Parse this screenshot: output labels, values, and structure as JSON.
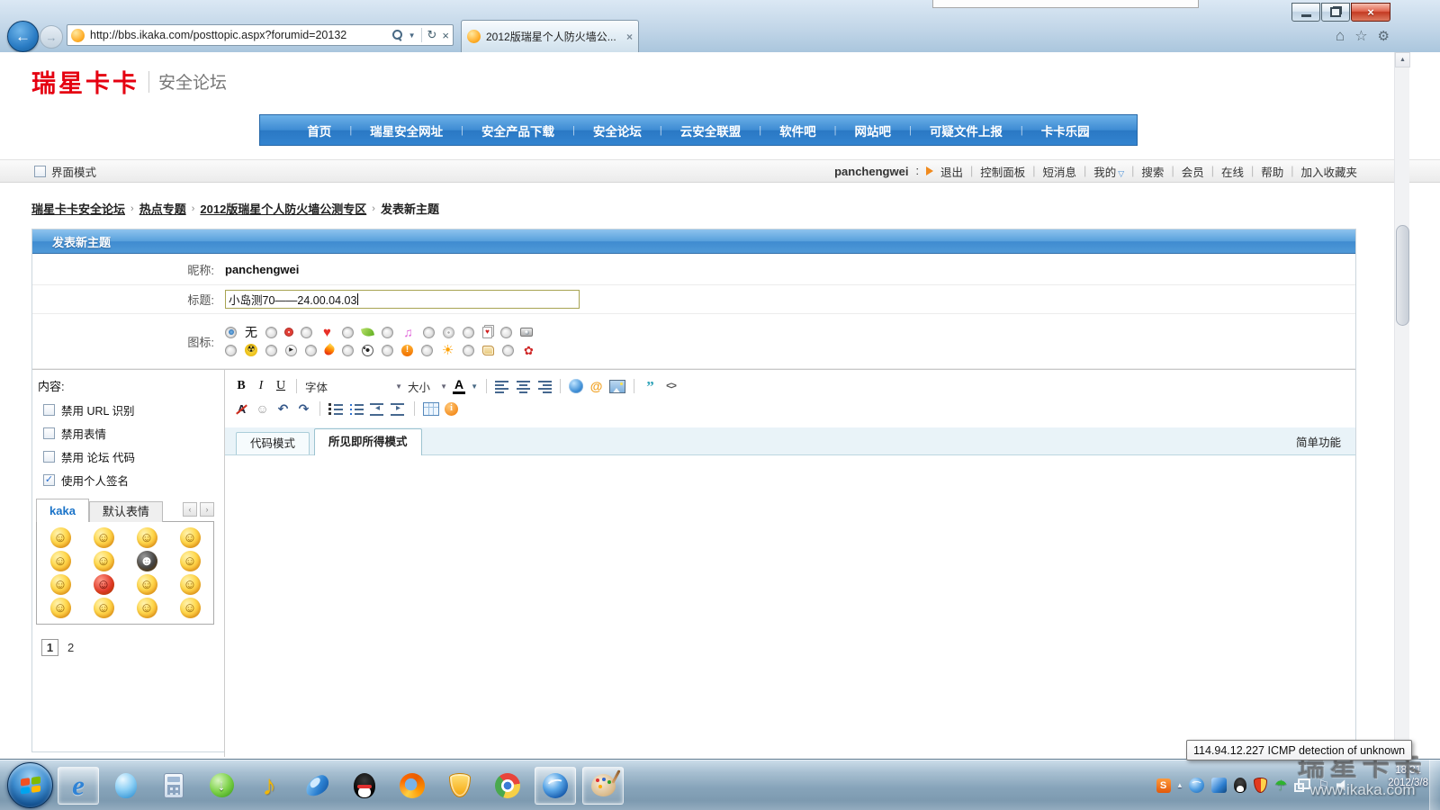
{
  "browser": {
    "url": "http://bbs.ikaka.com/posttopic.aspx?forumid=20132",
    "tab_title": "2012版瑞星个人防火墙公..."
  },
  "site": {
    "logo": "瑞星卡卡",
    "tagline": "安全论坛"
  },
  "nav": {
    "separator": "|",
    "items": [
      "首页",
      "瑞星安全网址",
      "安全产品下载",
      "安全论坛",
      "云安全联盟",
      "软件吧",
      "网站吧",
      "可疑文件上报",
      "卡卡乐园"
    ]
  },
  "userbar": {
    "interface_mode_label": "界面模式",
    "username": "panchengwei",
    "username_suffix": ":",
    "logout_label": "退出",
    "separator": "|",
    "links": [
      "控制面板",
      "短消息",
      "我的",
      "搜索",
      "会员",
      "在线",
      "帮助",
      "加入收藏夹"
    ]
  },
  "breadcrumb": {
    "separator": "›",
    "links": [
      "瑞星卡卡安全论坛",
      "热点专题",
      "2012版瑞星个人防火墙公测专区"
    ],
    "current": "发表新主题"
  },
  "post_form": {
    "panel_title": "发表新主题",
    "nickname_label": "昵称:",
    "nickname_value": "panchengwei",
    "title_label": "标题:",
    "title_value": "小岛测70——24.00.04.03",
    "icon_label": "图标:",
    "icon_none_label": "无",
    "icon_row1": [
      "lifebuoy",
      "heart",
      "leaf",
      "music-notes",
      "disc",
      "poker-cards",
      "camera"
    ],
    "icon_row2": [
      "radiation",
      "play",
      "flame",
      "soccer-ball",
      "alert",
      "sun",
      "scroll",
      "rose"
    ]
  },
  "content_options": {
    "label": "内容:",
    "checkboxes": [
      {
        "label": "禁用 URL 识别",
        "checked": false
      },
      {
        "label": "禁用表情",
        "checked": false
      },
      {
        "label": "禁用 论坛 代码",
        "checked": false
      },
      {
        "label": "使用个人签名",
        "checked": true
      }
    ]
  },
  "emoticon_panel": {
    "tabs": [
      {
        "label": "kaka",
        "active": true
      },
      {
        "label": "默认表情",
        "active": false
      }
    ],
    "smileys": [
      "smile",
      "laugh",
      "surprise",
      "cry",
      "shy",
      "sweat",
      "bomb-black",
      "shock",
      "sleepy",
      "angry-red",
      "doubt",
      "grin",
      "search",
      "kiss",
      "love",
      "tongue"
    ],
    "pages": [
      {
        "label": "1",
        "active": true
      },
      {
        "label": "2",
        "active": false
      }
    ]
  },
  "editor": {
    "bold_label": "B",
    "italic_label": "I",
    "underline_label": "U",
    "font_select_label": "字体",
    "size_select_label": "大小",
    "color_letter": "A",
    "toolbar_row1_icons": [
      "align-left",
      "align-center",
      "align-right",
      "link",
      "email",
      "image",
      "quote",
      "code"
    ],
    "toolbar_row2_icons": [
      "remove-format",
      "smiley",
      "undo",
      "redo",
      "ordered-list",
      "bullet-list",
      "outdent",
      "indent",
      "table",
      "info"
    ],
    "tabs": [
      {
        "label": "代码模式",
        "active": false
      },
      {
        "label": "所见即所得模式",
        "active": true
      }
    ],
    "simple_mode_label": "简单功能"
  },
  "tooltip": {
    "text": "114.94.12.227 ICMP detection of unknown"
  },
  "watermark": {
    "brand": "瑞星卡卡",
    "url": "www.ikaka.com"
  },
  "taskbar": {
    "apps": [
      {
        "name": "internet-explorer",
        "running": true
      },
      {
        "name": "pet-penguin",
        "running": false
      },
      {
        "name": "calculator",
        "running": false
      },
      {
        "name": "download-arrow",
        "running": false
      },
      {
        "name": "music-note",
        "running": false
      },
      {
        "name": "blue-bird",
        "running": false
      },
      {
        "name": "qq",
        "running": false
      },
      {
        "name": "firefox",
        "running": false
      },
      {
        "name": "security-shield",
        "running": false
      },
      {
        "name": "chrome",
        "running": false
      },
      {
        "name": "blue-globe",
        "running": true
      },
      {
        "name": "paint-palette",
        "running": true
      }
    ],
    "tray_icons": [
      "sogou-input",
      "hidden-icons",
      "blue-swirl",
      "tt-browser",
      "qq-mini",
      "rising-shield",
      "green-umbrella",
      "network",
      "flag",
      "volume"
    ],
    "clock": {
      "time": "18:31",
      "date": "2012/3/8"
    }
  }
}
